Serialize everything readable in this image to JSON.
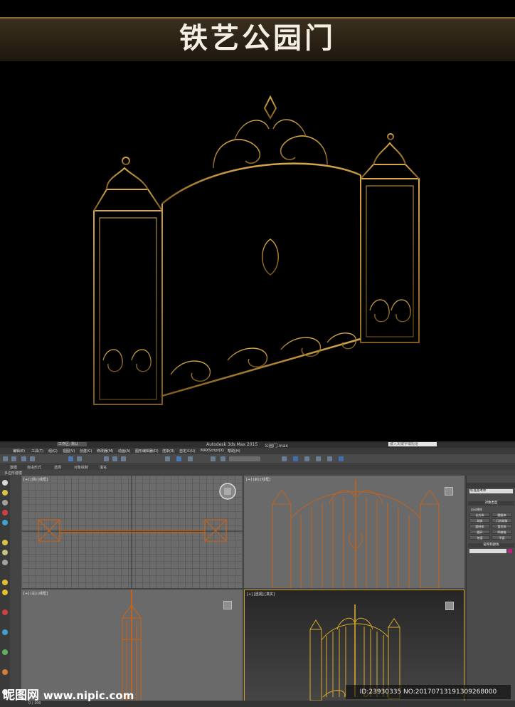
{
  "banner": {
    "title": "铁艺公园门"
  },
  "colors": {
    "gold": "#b8892e",
    "orange_wire": "#c4621a",
    "selection": "#c9a227",
    "banner_brown": "#3b2f1e"
  },
  "app": {
    "title": "Autodesk 3ds Max  2015",
    "file": "公园门.max",
    "workspace": "工作区: 默认",
    "search_placeholder": "键入关键字或短语",
    "menu": [
      "编辑(E)",
      "工具(T)",
      "组(G)",
      "视图(V)",
      "创建(C)",
      "修改器(M)",
      "动画(A)",
      "图形编辑器(D)",
      "渲染(R)",
      "自定义(U)",
      "MAXScript(X)",
      "帮助(H)"
    ],
    "ribbon_tabs": [
      "建模",
      "自由形式",
      "选择",
      "对象绘制",
      "填充"
    ],
    "ribbon_sub": "多边形建模"
  },
  "viewports": {
    "top": "[+] [顶] [线框]",
    "front": "[+] [前] [线框]",
    "left": "[+] [左] [线框]",
    "persp": "[+] [透视] [真实]"
  },
  "command_panel": {
    "dropdown": "标准基本体",
    "object_type": "对象类型",
    "autogrid": "自动栅格",
    "buttons": [
      "长方体",
      "圆锥体",
      "球体",
      "几何球体",
      "圆柱体",
      "管状体",
      "圆环",
      "四棱锥",
      "茶壶",
      "平面"
    ],
    "name_color": "名称和颜色"
  },
  "status": {
    "frame": "0 / 100"
  },
  "watermark": {
    "site_cn": "昵图网",
    "site_url": "www.nipic.com",
    "id_text": "ID:23930335 NO:20170713191309268000"
  }
}
